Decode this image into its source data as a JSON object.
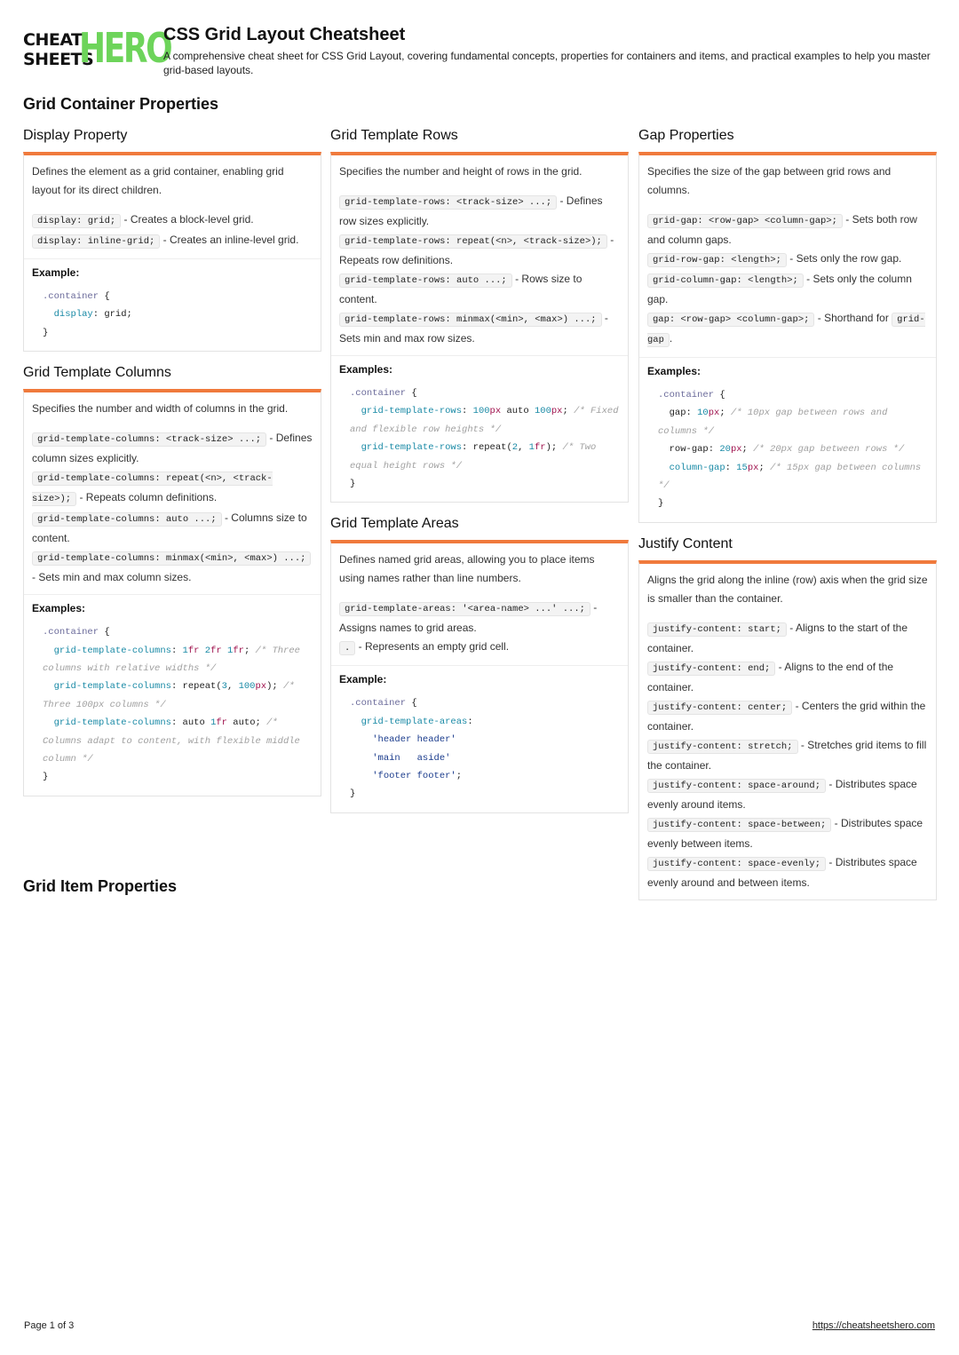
{
  "header": {
    "logo": {
      "line1": "CHEAT",
      "line2": "SHEETS",
      "brand": "HERO"
    },
    "title": "CSS Grid Layout Cheatsheet",
    "subtitle": "A comprehensive cheat sheet for CSS Grid Layout, covering fundamental concepts, properties for containers and items, and practical examples to help you master grid-based layouts."
  },
  "sections": {
    "container": "Grid Container Properties",
    "item": "Grid Item Properties"
  },
  "colors": {
    "accent": "#f07a3c",
    "brand_green": "#6dd45a"
  },
  "cards": {
    "display": {
      "title": "Display Property",
      "desc": "Defines the element as a grid container, enabling grid layout for its direct children.",
      "items": [
        {
          "code": "display: grid;",
          "text": " - Creates a block-level grid."
        },
        {
          "code": "display: inline-grid;",
          "text": " - Creates an inline-level grid."
        }
      ],
      "example_label": "Example:"
    },
    "columns": {
      "title": "Grid Template Columns",
      "desc": "Specifies the number and width of columns in the grid.",
      "items": [
        {
          "code": "grid-template-columns: <track-size> ...;",
          "text": " - Defines column sizes explicitly."
        },
        {
          "code": "grid-template-columns: repeat(<n>, <track-size>);",
          "text": " - Repeats column definitions."
        },
        {
          "code": "grid-template-columns: auto ...;",
          "text": " - Columns size to content."
        },
        {
          "code": "grid-template-columns: minmax(<min>, <max>) ...;",
          "text": " - Sets min and max column sizes."
        }
      ],
      "example_label": "Examples:"
    },
    "rows": {
      "title": "Grid Template Rows",
      "desc": "Specifies the number and height of rows in the grid.",
      "items": [
        {
          "code": "grid-template-rows: <track-size> ...;",
          "text": " - Defines row sizes explicitly."
        },
        {
          "code": "grid-template-rows: repeat(<n>, <track-size>);",
          "text": " - Repeats row definitions."
        },
        {
          "code": "grid-template-rows: auto ...;",
          "text": " - Rows size to content."
        },
        {
          "code": "grid-template-rows: minmax(<min>, <max>) ...;",
          "text": " - Sets min and max row sizes."
        }
      ],
      "example_label": "Examples:"
    },
    "areas": {
      "title": "Grid Template Areas",
      "desc": "Defines named grid areas, allowing you to place items using names rather than line numbers.",
      "items": [
        {
          "code": "grid-template-areas: '<area-name> ...' ...;",
          "text": " - Assigns names to grid areas."
        },
        {
          "code": ".",
          "text": " - Represents an empty grid cell."
        }
      ],
      "example_label": "Example:"
    },
    "gap": {
      "title": "Gap Properties",
      "desc": "Specifies the size of the gap between grid rows and columns.",
      "items": [
        {
          "code": "grid-gap: <row-gap> <column-gap>;",
          "text": " - Sets both row and column gaps."
        },
        {
          "code": "grid-row-gap: <length>;",
          "text": " - Sets only the row gap."
        },
        {
          "code": "grid-column-gap: <length>;",
          "text": " - Sets only the column gap."
        },
        {
          "code": "gap: <row-gap> <column-gap>;",
          "text": " - Shorthand for ",
          "code2": "grid-gap",
          "text2": "."
        }
      ],
      "example_label": "Examples:"
    },
    "justify": {
      "title": "Justify Content",
      "desc": "Aligns the grid along the inline (row) axis when the grid size is smaller than the container.",
      "items": [
        {
          "code": "justify-content: start;",
          "text": " - Aligns to the start of the container."
        },
        {
          "code": "justify-content: end;",
          "text": " - Aligns to the end of the container."
        },
        {
          "code": "justify-content: center;",
          "text": " - Centers the grid within the container."
        },
        {
          "code": "justify-content: stretch;",
          "text": " - Stretches grid items to fill the container."
        },
        {
          "code": "justify-content: space-around;",
          "text": " - Distributes space evenly around items."
        },
        {
          "code": "justify-content: space-between;",
          "text": " - Distributes space evenly between items."
        },
        {
          "code": "justify-content: space-evenly;",
          "text": " - Distributes space evenly around and between items."
        }
      ]
    }
  },
  "code": {
    "selector": ".container",
    "open": " {",
    "close": "}",
    "display": {
      "prop": "display",
      "value": "grid;"
    },
    "columns": {
      "prop": "grid-template-columns",
      "l1": {
        "n1": "1",
        "u1": "fr",
        "n2": "2",
        "u2": "fr",
        "n3": "1",
        "u3": "fr",
        "comment": "/* Three columns with relative widths */"
      },
      "l2": {
        "pre": "repeat(",
        "n1": "3",
        "mid": ", ",
        "n2": "100",
        "u2": "px",
        "post": ");",
        "comment": "/* Three 100px columns */"
      },
      "l3": {
        "pre": "auto ",
        "n1": "1",
        "u1": "fr",
        "post": " auto;",
        "comment": "/* Columns adapt to content, with flexible middle column */"
      }
    },
    "rows": {
      "prop": "grid-template-rows",
      "l1": {
        "n1": "100",
        "u1": "px",
        "mid": " auto ",
        "n2": "100",
        "u2": "px",
        "comment": "/* Fixed and flexible row heights */"
      },
      "l2": {
        "pre": "repeat(",
        "n1": "2",
        "mid": ", ",
        "n2": "1",
        "u2": "fr",
        "post": ");",
        "comment": "/* Two equal height rows */"
      }
    },
    "areas": {
      "prop": "grid-template-areas",
      "lines": [
        "'header header'",
        "'main   aside'",
        "'footer footer'"
      ]
    },
    "gap": {
      "l1": {
        "prop": "gap",
        "n": "10",
        "u": "px",
        "comment": "/* 10px gap between rows and columns */"
      },
      "l2": {
        "prop": "row-gap",
        "n": "20",
        "u": "px",
        "comment": "/* 20px gap between rows */"
      },
      "l3": {
        "prop": "column-gap",
        "n": "15",
        "u": "px",
        "comment": "/* 15px gap between columns */"
      }
    }
  },
  "footer": {
    "page": "Page 1 of 3",
    "link": "https://cheatsheetshero.com"
  }
}
